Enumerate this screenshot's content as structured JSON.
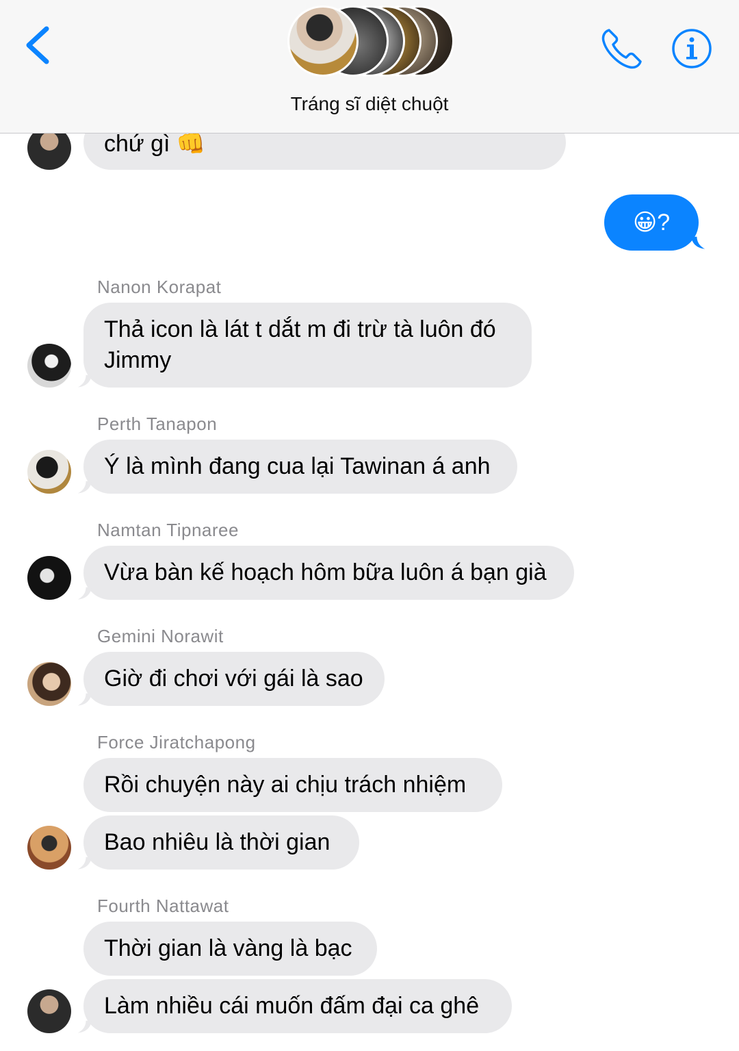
{
  "header": {
    "title": "Tráng sĩ diệt chuột",
    "back_icon": "chevron-left-icon",
    "call_icon": "phone-icon",
    "info_icon": "info-icon",
    "accent_color": "#0b84ff"
  },
  "messages": {
    "m0": {
      "text": "chứ gì 👊"
    },
    "out": {
      "text": "😀?"
    },
    "m1": {
      "sender": "Nanon Korapat",
      "line1": "Thả icon là lát t dắt m đi trừ tà luôn đó",
      "line2": "Jimmy"
    },
    "m2": {
      "sender": "Perth Tanapon",
      "text": "Ý là mình đang cua lại Tawinan á anh"
    },
    "m3": {
      "sender": "Namtan Tipnaree",
      "text": "Vừa bàn kế hoạch hôm bữa luôn á bạn già"
    },
    "m4": {
      "sender": "Gemini Norawit",
      "text": "Giờ đi chơi với gái là sao"
    },
    "m5": {
      "sender": "Force Jiratchapong",
      "text1": "Rồi chuyện này ai chịu trách nhiệm",
      "text2": "Bao nhiêu là thời gian"
    },
    "m6": {
      "sender": "Fourth Nattawat",
      "text1": "Thời gian là vàng là bạc",
      "text2": "Làm nhiều cái muốn đấm đại ca ghê"
    }
  },
  "colors": {
    "incoming_bubble": "#e9e9eb",
    "outgoing_bubble": "#0b84ff",
    "sender_name": "#8a8a8e"
  }
}
